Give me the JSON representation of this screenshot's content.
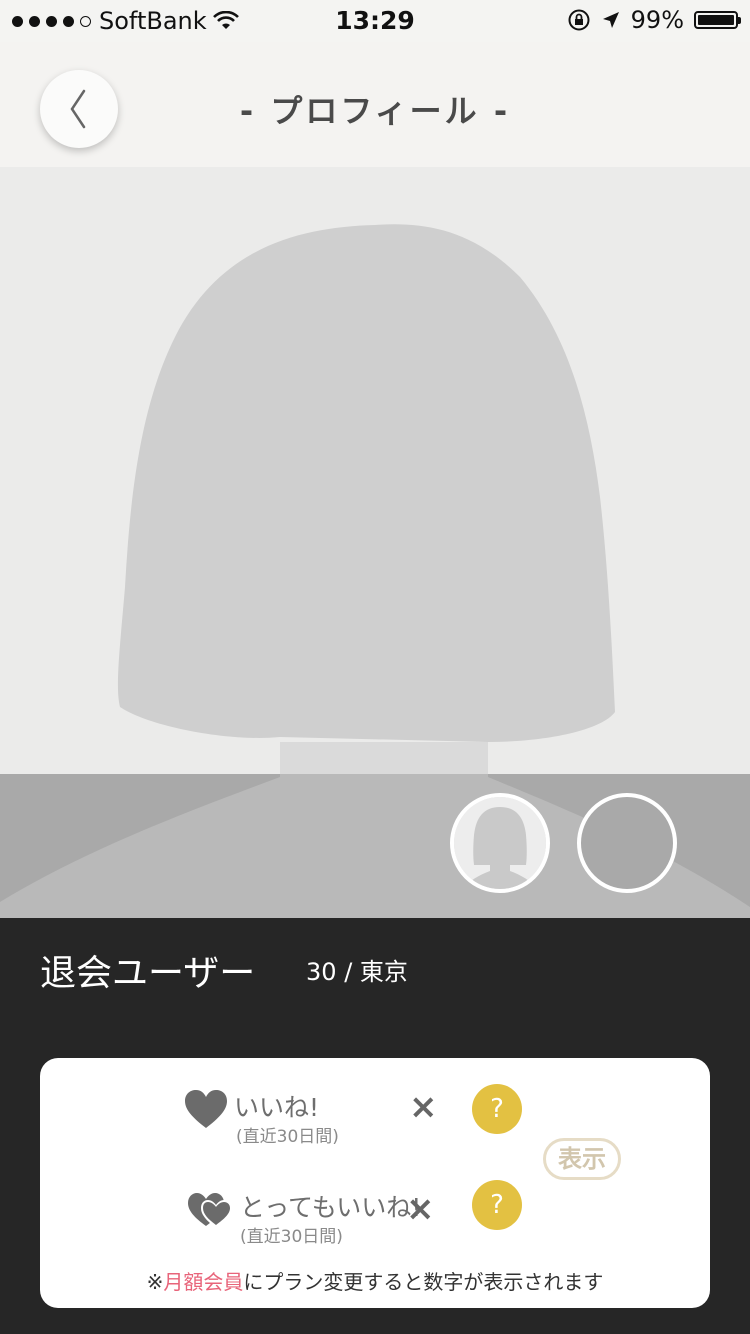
{
  "status_bar": {
    "carrier": "SoftBank",
    "time": "13:29",
    "battery": "99%",
    "battery_level": 0.99,
    "signal_dots_filled": 4,
    "signal_dots_total": 5
  },
  "header": {
    "title": "- プロフィール -"
  },
  "profile": {
    "name": "退会ユーザー",
    "age": "30",
    "separator": "/",
    "location": "東京"
  },
  "stats": {
    "like": {
      "label": "いいね!",
      "period": "(直近30日間)",
      "multiplier": "×",
      "value": "?"
    },
    "super_like": {
      "label": "とってもいいね!",
      "period": "(直近30日間)",
      "multiplier": "×",
      "value": "?"
    },
    "show_button": "表示",
    "note_prefix": "※",
    "note_highlight": "月額会員",
    "note_suffix": "にプラン変更すると数字が表示されます"
  },
  "colors": {
    "accent_yellow": "#e3c142",
    "highlight_pink": "#e8647a",
    "panel_dark": "#262626"
  },
  "icons": [
    "back-chevron-icon",
    "wifi-icon",
    "rotation-lock-icon",
    "location-arrow-icon",
    "battery-icon",
    "heart-icon",
    "double-heart-icon"
  ]
}
